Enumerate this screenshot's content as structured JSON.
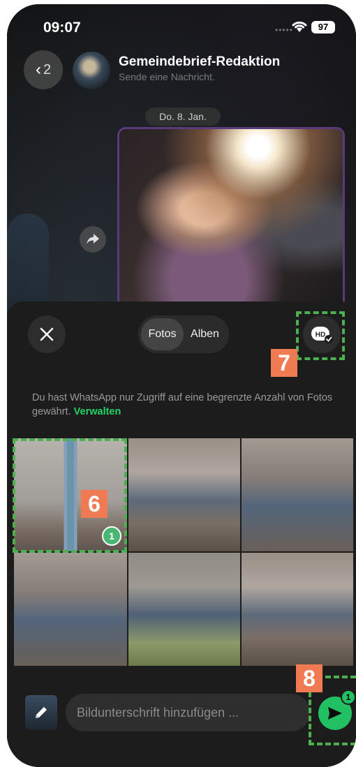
{
  "status_bar": {
    "time": "09:07",
    "battery": "97"
  },
  "header": {
    "back_count": "2",
    "title": "Gemeindebrief-Redaktion",
    "subtitle": "Sende eine Nachricht."
  },
  "chat": {
    "date_label": "Do. 8. Jan."
  },
  "picker": {
    "tabs": [
      {
        "label": "Fotos",
        "active": true
      },
      {
        "label": "Alben",
        "active": false
      }
    ],
    "hd_label": "HD",
    "notice_text": "Du hast WhatsApp nur Zugriff auf eine begrenzte Anzahl von Fotos gewährt.",
    "notice_link": "Verwalten",
    "selected_badge": "1"
  },
  "compose": {
    "caption_placeholder": "Bildunterschrift hinzufügen ...",
    "send_count": "1"
  },
  "annotations": [
    "6",
    "7",
    "8"
  ],
  "colors": {
    "accent_green": "#25d366",
    "annotation_border": "#4caf50",
    "annotation_label": "#f07a52"
  }
}
